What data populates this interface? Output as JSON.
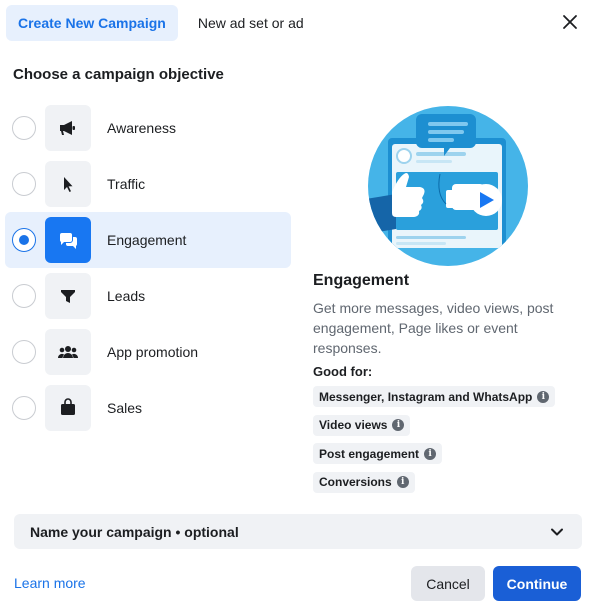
{
  "tabs": [
    {
      "label": "Create New Campaign",
      "active": true
    },
    {
      "label": "New ad set or ad",
      "active": false
    }
  ],
  "heading": "Choose a campaign objective",
  "objectives": [
    {
      "label": "Awareness",
      "icon": "megaphone-icon",
      "selected": false
    },
    {
      "label": "Traffic",
      "icon": "cursor-icon",
      "selected": false
    },
    {
      "label": "Engagement",
      "icon": "chat-bubbles-icon",
      "selected": true
    },
    {
      "label": "Leads",
      "icon": "funnel-icon",
      "selected": false
    },
    {
      "label": "App promotion",
      "icon": "people-icon",
      "selected": false
    },
    {
      "label": "Sales",
      "icon": "shopping-bag-icon",
      "selected": false
    }
  ],
  "detail": {
    "title": "Engagement",
    "description": "Get more messages, video views, post engagement, Page likes or event responses.",
    "good_for_label": "Good for:",
    "good_for": [
      "Messenger, Instagram and WhatsApp",
      "Video views",
      "Post engagement",
      "Conversions"
    ]
  },
  "name_campaign": "Name your campaign • optional",
  "footer": {
    "learn_more": "Learn more",
    "cancel": "Cancel",
    "continue": "Continue"
  },
  "colors": {
    "accent": "#1a73e8",
    "primary_button": "#1a5fd6",
    "selected_bg": "#e7f0fd",
    "chip_bg": "#f0f2f5"
  }
}
